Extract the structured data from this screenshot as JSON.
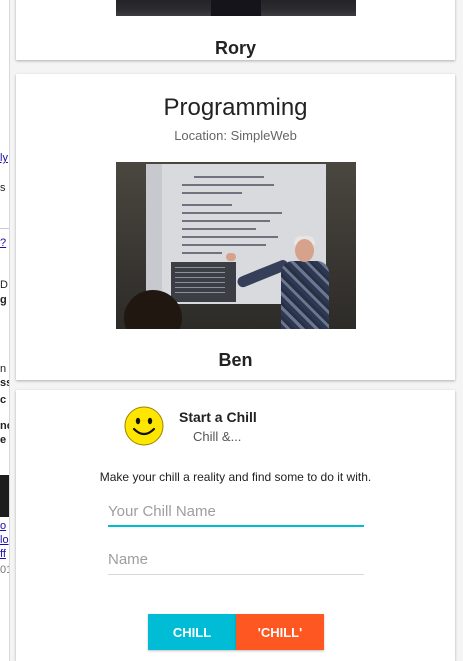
{
  "background_page": {
    "fragments": [
      "ly",
      "s",
      "?",
      "D",
      "g",
      "n",
      "ss",
      "c",
      "nc",
      "e",
      "o",
      "lo",
      "ff",
      "01"
    ]
  },
  "cards": [
    {
      "name": "Rory"
    },
    {
      "title": "Programming",
      "location_label": "Location:",
      "location_value": "SimpleWeb",
      "name": "Ben"
    }
  ],
  "chill_form": {
    "icon": "smiley-face-icon",
    "title": "Start a Chill",
    "subtitle": "Chill &...",
    "tagline": "Make your chill a reality and find some to do it with.",
    "chill_name_placeholder": "Your Chill Name",
    "name_placeholder": "Name",
    "buttons": {
      "chill": "CHILL",
      "chill_quoted": "'CHILL'"
    }
  },
  "colors": {
    "accent_cyan": "#00bcd4",
    "accent_orange": "#ff5722"
  }
}
